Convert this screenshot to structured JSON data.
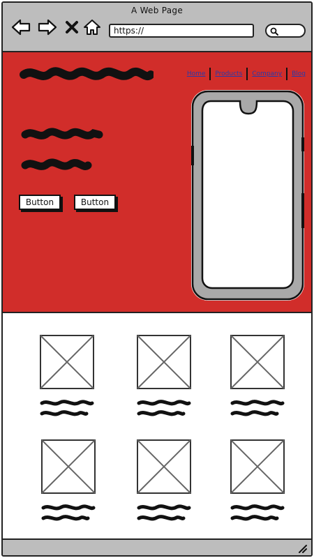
{
  "window": {
    "title": "A Web Page"
  },
  "toolbar": {
    "address": "https://",
    "icons": [
      "back-arrow-icon",
      "forward-arrow-icon",
      "close-x-icon",
      "home-icon",
      "search-icon"
    ]
  },
  "nav": {
    "links": [
      "Home",
      "Products",
      "Company",
      "Blog"
    ]
  },
  "hero": {
    "background": "#d12d2a",
    "buttons": [
      "Button",
      "Button"
    ]
  },
  "grid": {
    "item_count": 6
  }
}
